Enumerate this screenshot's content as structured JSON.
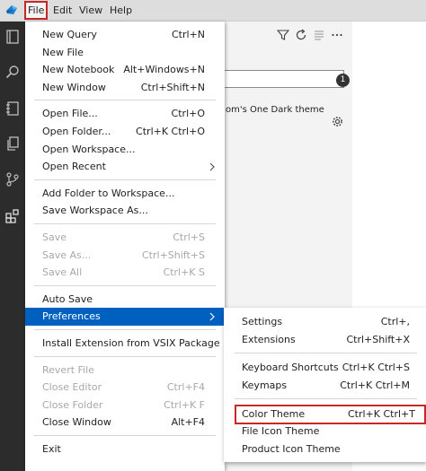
{
  "menubar": {
    "items": [
      {
        "label": "File",
        "active": true
      },
      {
        "label": "Edit"
      },
      {
        "label": "View"
      },
      {
        "label": "Help"
      }
    ]
  },
  "activity_bar": {
    "icons": [
      "explorer-icon",
      "search-icon",
      "notebook-icon",
      "files-icon",
      "source-control-icon",
      "extensions-icon"
    ]
  },
  "side_panel": {
    "badge": "1",
    "extension_text": "om's One Dark theme"
  },
  "file_menu": {
    "groups": [
      [
        {
          "label": "New Query",
          "shortcut": "Ctrl+N"
        },
        {
          "label": "New File",
          "shortcut": ""
        },
        {
          "label": "New Notebook",
          "shortcut": "Alt+Windows+N"
        },
        {
          "label": "New Window",
          "shortcut": "Ctrl+Shift+N"
        }
      ],
      [
        {
          "label": "Open File...",
          "shortcut": "Ctrl+O"
        },
        {
          "label": "Open Folder...",
          "shortcut": "Ctrl+K Ctrl+O"
        },
        {
          "label": "Open Workspace...",
          "shortcut": ""
        },
        {
          "label": "Open Recent",
          "shortcut": "",
          "submenu": true
        }
      ],
      [
        {
          "label": "Add Folder to Workspace...",
          "shortcut": ""
        },
        {
          "label": "Save Workspace As...",
          "shortcut": ""
        }
      ],
      [
        {
          "label": "Save",
          "shortcut": "Ctrl+S",
          "disabled": true
        },
        {
          "label": "Save As...",
          "shortcut": "Ctrl+Shift+S",
          "disabled": true
        },
        {
          "label": "Save All",
          "shortcut": "Ctrl+K S",
          "disabled": true
        }
      ],
      [
        {
          "label": "Auto Save",
          "shortcut": ""
        },
        {
          "label": "Preferences",
          "shortcut": "",
          "submenu": true,
          "highlight": true
        }
      ],
      [
        {
          "label": "Install Extension from VSIX Package",
          "shortcut": ""
        }
      ],
      [
        {
          "label": "Revert File",
          "shortcut": "",
          "disabled": true
        },
        {
          "label": "Close Editor",
          "shortcut": "Ctrl+F4",
          "disabled": true
        },
        {
          "label": "Close Folder",
          "shortcut": "Ctrl+K F",
          "disabled": true
        },
        {
          "label": "Close Window",
          "shortcut": "Alt+F4"
        }
      ],
      [
        {
          "label": "Exit",
          "shortcut": ""
        }
      ]
    ]
  },
  "preferences_menu": {
    "groups": [
      [
        {
          "label": "Settings",
          "shortcut": "Ctrl+,"
        },
        {
          "label": "Extensions",
          "shortcut": "Ctrl+Shift+X"
        }
      ],
      [
        {
          "label": "Keyboard Shortcuts",
          "shortcut": "Ctrl+K Ctrl+S"
        },
        {
          "label": "Keymaps",
          "shortcut": "Ctrl+K Ctrl+M"
        }
      ],
      [
        {
          "label": "Color Theme",
          "shortcut": "Ctrl+K Ctrl+T",
          "boxed": true
        },
        {
          "label": "File Icon Theme",
          "shortcut": ""
        },
        {
          "label": "Product Icon Theme",
          "shortcut": ""
        }
      ]
    ]
  },
  "colors": {
    "highlight": "#0060c0",
    "annotation_box": "#c62828",
    "activity_bar": "#2c2c2c"
  }
}
